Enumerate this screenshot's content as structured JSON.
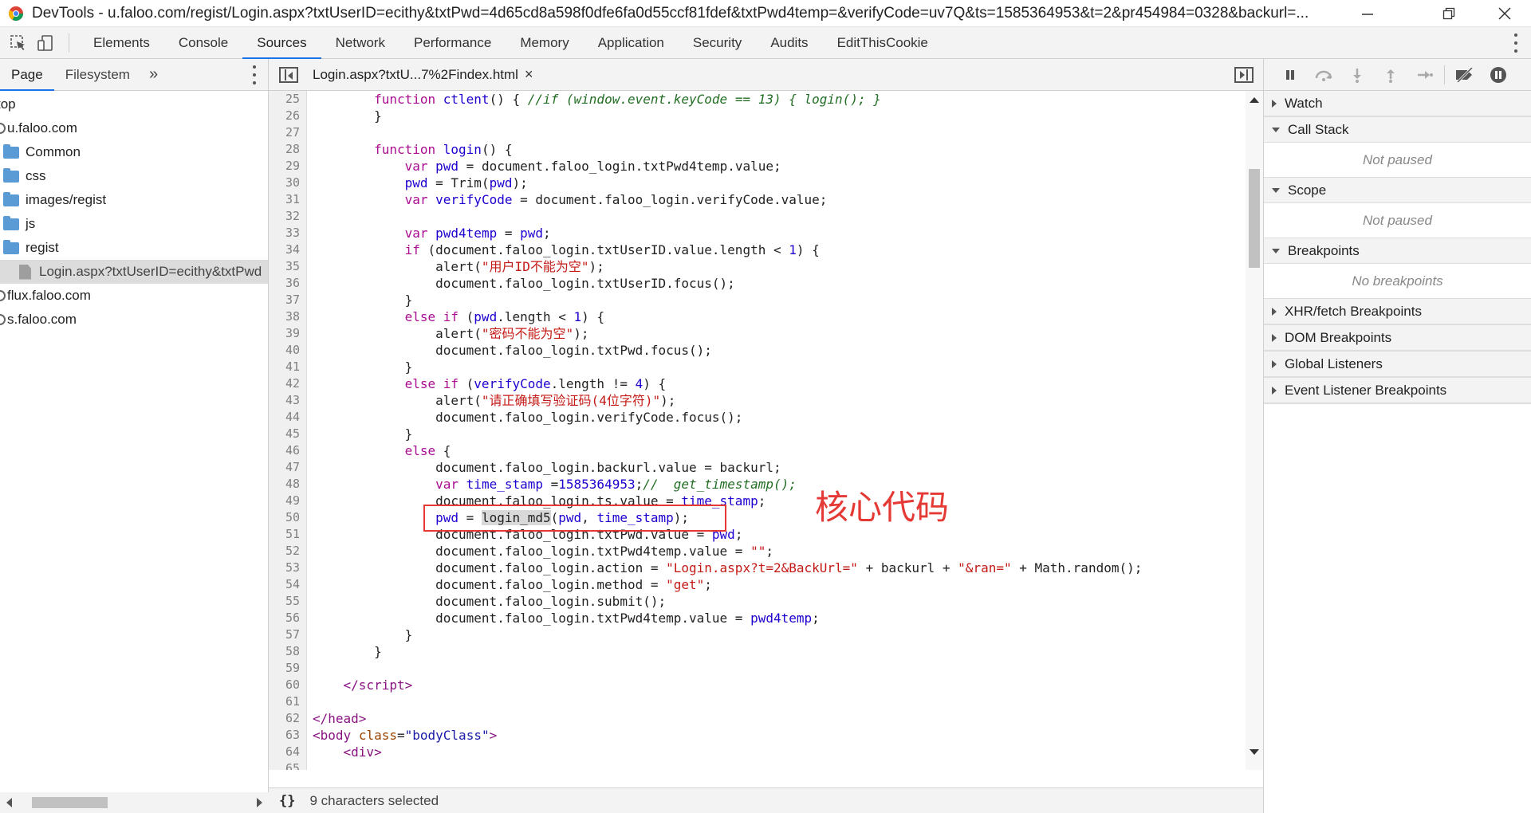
{
  "window": {
    "title": "DevTools - u.faloo.com/regist/Login.aspx?txtUserID=ecithy&txtPwd=4d65cd8a598f0dfe6fa0d55ccf81fdef&txtPwd4temp=&verifyCode=uv7Q&ts=1585364953&t=2&pr454984=0328&backurl=...",
    "minimize_icon": "minimize-icon",
    "restore_icon": "restore-icon",
    "close_icon": "close-icon"
  },
  "main_tabs": [
    {
      "label": "Elements"
    },
    {
      "label": "Console"
    },
    {
      "label": "Sources",
      "active": true
    },
    {
      "label": "Network"
    },
    {
      "label": "Performance"
    },
    {
      "label": "Memory"
    },
    {
      "label": "Application"
    },
    {
      "label": "Security"
    },
    {
      "label": "Audits"
    },
    {
      "label": "EditThisCookie"
    }
  ],
  "navigator": {
    "tabs": [
      {
        "label": "Page",
        "active": true
      },
      {
        "label": "Filesystem"
      }
    ],
    "more": "»",
    "tree": [
      {
        "label": "top",
        "type": "frame",
        "indent": 0
      },
      {
        "label": "u.faloo.com",
        "type": "domain",
        "indent": 1
      },
      {
        "label": "Common",
        "type": "folder",
        "indent": 2
      },
      {
        "label": "css",
        "type": "folder",
        "indent": 2
      },
      {
        "label": "images/regist",
        "type": "folder",
        "indent": 2
      },
      {
        "label": "js",
        "type": "folder",
        "indent": 2
      },
      {
        "label": "regist",
        "type": "folder",
        "indent": 2
      },
      {
        "label": "Login.aspx?txtUserID=ecithy&txtPwd",
        "type": "file",
        "indent": 3,
        "selected": true
      },
      {
        "label": "flux.faloo.com",
        "type": "domain",
        "indent": 1
      },
      {
        "label": "s.faloo.com",
        "type": "domain",
        "indent": 1
      }
    ]
  },
  "editor": {
    "file_tab": "Login.aspx?txtU...7%2Findex.html",
    "close": "×",
    "line_numbers": [
      "25",
      "26",
      "27",
      "28",
      "29",
      "30",
      "31",
      "32",
      "33",
      "34",
      "35",
      "36",
      "37",
      "38",
      "39",
      "40",
      "41",
      "42",
      "43",
      "44",
      "45",
      "46",
      "47",
      "48",
      "49",
      "50",
      "51",
      "52",
      "53",
      "54",
      "55",
      "56",
      "57",
      "58",
      "59",
      "60",
      "61",
      "62",
      "63",
      "64",
      "65"
    ],
    "status": "9 characters selected",
    "pretty_print": "{}"
  },
  "annotation": {
    "text": "核心代码",
    "color": "#e53935"
  },
  "debugger": {
    "sections": [
      {
        "label": "Watch",
        "expanded": false
      },
      {
        "label": "Call Stack",
        "expanded": true,
        "body": "Not paused"
      },
      {
        "label": "Scope",
        "expanded": true,
        "body": "Not paused"
      },
      {
        "label": "Breakpoints",
        "expanded": true,
        "body": "No breakpoints"
      },
      {
        "label": "XHR/fetch Breakpoints",
        "expanded": false
      },
      {
        "label": "DOM Breakpoints",
        "expanded": false
      },
      {
        "label": "Global Listeners",
        "expanded": false
      },
      {
        "label": "Event Listener Breakpoints",
        "expanded": false
      }
    ]
  },
  "colors": {
    "accent": "#1a73e8",
    "highlight": "#e53935",
    "keyword": "#aa0d91",
    "string": "#c41a16",
    "comment": "#236e25"
  }
}
